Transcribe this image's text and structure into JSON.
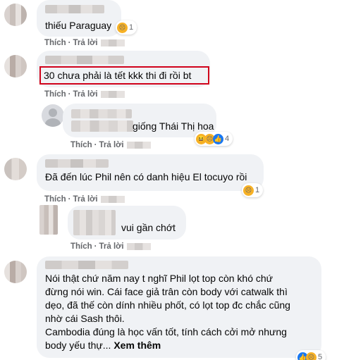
{
  "comments": [
    {
      "text": "thiếu Paraguay",
      "actions": {
        "like": "Thích",
        "reply": "Trả lời"
      },
      "reaction": {
        "icon": "sad-emoji",
        "count": "1"
      }
    },
    {
      "text": "30 chưa phải là tết kkk thi đi rồi bt",
      "actions": {
        "like": "Thích",
        "reply": "Trả lời"
      },
      "highlight_color": "#d0021b"
    },
    {
      "text": "giống Thái Thị hoa",
      "actions": {
        "like": "Thích",
        "reply": "Trả lời"
      },
      "reaction": {
        "icons": [
          "haha-emoji",
          "sad-emoji",
          "like-icon"
        ],
        "count": "4"
      }
    },
    {
      "text": "Đã đến lúc Phil nên có danh hiệu El tocuyo rồi",
      "actions": {
        "like": "Thích",
        "reply": "Trả lời"
      },
      "reaction": {
        "icon": "sad-emoji",
        "count": "1"
      }
    },
    {
      "text": "vui gần chớt",
      "actions": {
        "like": "Thích",
        "reply": "Trả lời"
      }
    },
    {
      "text_lines": [
        "Nói thật chứ năm nay t nghĩ Phil lọt top còn khó chứ",
        "đừng nói win. Cái face giả trân còn body với catwalk thì",
        "dẹo, đã thế còn dính nhiều phốt, có lọt top đc chắc cũng",
        "nhờ cái Sash thôi.",
        "Cambodia đúng là học vấn tốt, tính cách cởi mở nhưng"
      ],
      "last_line_prefix": "body yếu thự...",
      "see_more": "Xem thêm",
      "reaction": {
        "icons": [
          "like-icon",
          "sad-emoji"
        ],
        "count": "5"
      }
    }
  ],
  "colors": {
    "bubble": "#f0f2f5",
    "meta_text": "#65676b",
    "highlight": "#d0021b"
  }
}
